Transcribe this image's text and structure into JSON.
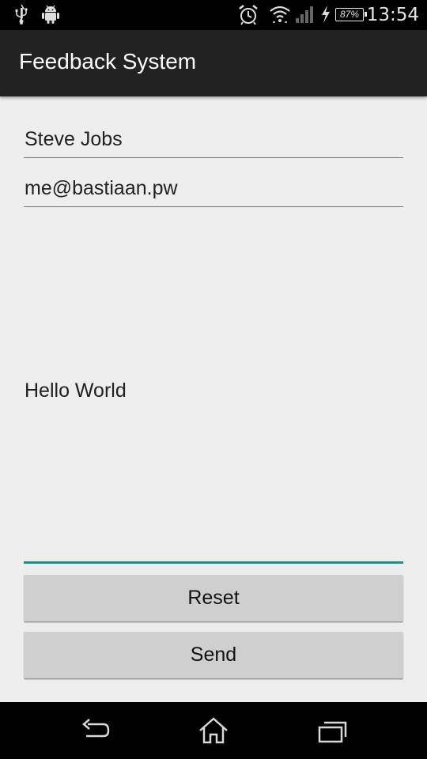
{
  "status_bar": {
    "time": "13:54",
    "battery_percent": "87%",
    "icons": [
      "usb-icon",
      "android-icon",
      "alarm-icon",
      "wifi-icon",
      "signal-icon",
      "charging-icon",
      "battery-icon"
    ]
  },
  "action_bar": {
    "title": "Feedback System"
  },
  "form": {
    "name_value": "Steve Jobs",
    "email_value": "me@bastiaan.pw",
    "message_value": "Hello World",
    "reset_label": "Reset",
    "send_label": "Send"
  },
  "nav_bar": {
    "icons": [
      "back-icon",
      "home-icon",
      "recent-apps-icon"
    ]
  },
  "colors": {
    "accent": "#12968c",
    "action_bar": "#222222",
    "background": "#eeeeee",
    "button": "#cfcfcf"
  }
}
